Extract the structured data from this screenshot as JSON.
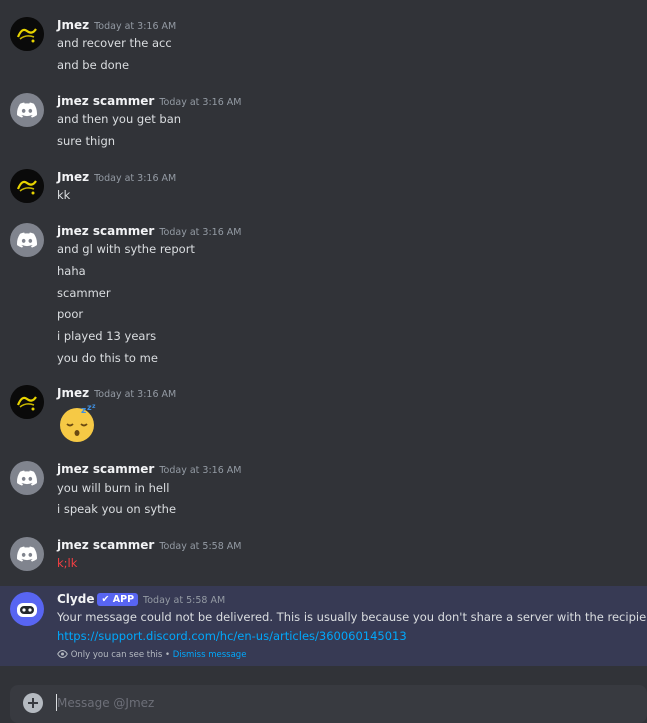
{
  "composer": {
    "placeholder": "Message @Jmez"
  },
  "messages": [
    {
      "username": "Jmez",
      "timestamp": "Today at 3:16 AM",
      "avatar": "jmez-logo",
      "lines": [
        "and recover the acc",
        "and be done"
      ]
    },
    {
      "username": "jmez scammer",
      "timestamp": "Today at 3:16 AM",
      "avatar": "discord-default",
      "lines": [
        "and then you get ban",
        "sure thign"
      ]
    },
    {
      "username": "Jmez",
      "timestamp": "Today at 3:16 AM",
      "avatar": "jmez-logo",
      "lines": [
        "kk"
      ]
    },
    {
      "username": "jmez scammer",
      "timestamp": "Today at 3:16 AM",
      "avatar": "discord-default",
      "lines": [
        "and gl with sythe report",
        "haha",
        "scammer",
        "poor",
        "i played 13 years",
        "you do this to me"
      ]
    },
    {
      "username": "Jmez",
      "timestamp": "Today at 3:16 AM",
      "avatar": "jmez-logo",
      "emoji": "sleeping-face"
    },
    {
      "username": "jmez scammer",
      "timestamp": "Today at 3:16 AM",
      "avatar": "discord-default",
      "lines": [
        "you will burn in hell",
        "i speak you on sythe"
      ]
    },
    {
      "username": "jmez scammer",
      "timestamp": "Today at 5:58 AM",
      "avatar": "discord-default",
      "lines": [
        "k;lk"
      ],
      "failed": true
    },
    {
      "username": "Clyde",
      "badge": "APP",
      "timestamp": "Today at 5:58 AM",
      "avatar": "clyde-bot",
      "lines": [
        "Your message could not be delivered. This is usually because you don't share a server with the recipient o"
      ],
      "link": "https://support.discord.com/hc/en-us/articles/360060145013",
      "ephemeral_note": "Only you can see this",
      "separator": "•",
      "dismiss_label": "Dismiss message"
    }
  ],
  "colors": {
    "background": "#313338",
    "username": "#f2f3f5",
    "failed_text": "#f23f43",
    "link": "#00a8fc",
    "blurple": "#5865f2",
    "ephemeral_bg": "#373a54"
  }
}
